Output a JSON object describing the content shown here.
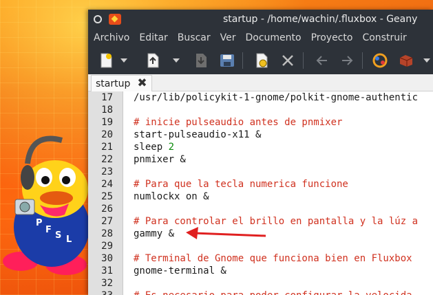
{
  "window": {
    "title": "startup - /home/wachin/.fluxbox - Geany"
  },
  "menu": [
    "Archivo",
    "Editar",
    "Buscar",
    "Ver",
    "Documento",
    "Proyecto",
    "Construir"
  ],
  "toolbar_icons": [
    "new-file-icon",
    "open-file-icon",
    "dropdown-icon",
    "save-icon",
    "save-all-icon",
    "revert-icon",
    "close-file-icon",
    "back-arrow-icon",
    "forward-arrow-icon",
    "color-picker-icon",
    "build-icon"
  ],
  "tab": {
    "label": "startup",
    "close_glyph": "✖"
  },
  "editor": {
    "lines": [
      {
        "num": "17",
        "parts": [
          {
            "t": "/usr/lib/policykit-1-gnome/polkit-gnome-authentic",
            "k": "plain"
          }
        ]
      },
      {
        "num": "18",
        "parts": []
      },
      {
        "num": "19",
        "parts": [
          {
            "t": "# inicie pulseaudio antes de pnmixer",
            "k": "comment"
          }
        ]
      },
      {
        "num": "20",
        "parts": [
          {
            "t": "start-pulseaudio-x11 &",
            "k": "plain"
          }
        ]
      },
      {
        "num": "21",
        "parts": [
          {
            "t": "sleep ",
            "k": "plain"
          },
          {
            "t": "2",
            "k": "num"
          }
        ]
      },
      {
        "num": "22",
        "parts": [
          {
            "t": "pnmixer &",
            "k": "plain"
          }
        ]
      },
      {
        "num": "23",
        "parts": []
      },
      {
        "num": "24",
        "parts": [
          {
            "t": "# Para que la tecla numerica funcione",
            "k": "comment"
          }
        ]
      },
      {
        "num": "25",
        "parts": [
          {
            "t": "numlockx on &",
            "k": "plain"
          }
        ]
      },
      {
        "num": "26",
        "parts": []
      },
      {
        "num": "27",
        "parts": [
          {
            "t": "# Para controlar el brillo en pantalla y la lúz a",
            "k": "comment"
          }
        ]
      },
      {
        "num": "28",
        "parts": [
          {
            "t": "gammy &",
            "k": "plain"
          }
        ]
      },
      {
        "num": "29",
        "parts": []
      },
      {
        "num": "30",
        "parts": [
          {
            "t": "# Terminal de Gnome que funciona bien en Fluxbox",
            "k": "comment"
          }
        ]
      },
      {
        "num": "31",
        "parts": [
          {
            "t": "gnome-terminal &",
            "k": "plain"
          }
        ]
      },
      {
        "num": "32",
        "parts": []
      },
      {
        "num": "33",
        "parts": [
          {
            "t": "# Es necesario para poder configurar la velocida",
            "k": "comment"
          }
        ]
      }
    ]
  },
  "desktop": {
    "mascot_letters": [
      "P",
      "F",
      "S",
      "L"
    ]
  },
  "colors": {
    "comment": "#d0311f",
    "number": "#0a8a0a",
    "annotation_arrow": "#e02020",
    "dark_chrome": "#2d3239"
  }
}
